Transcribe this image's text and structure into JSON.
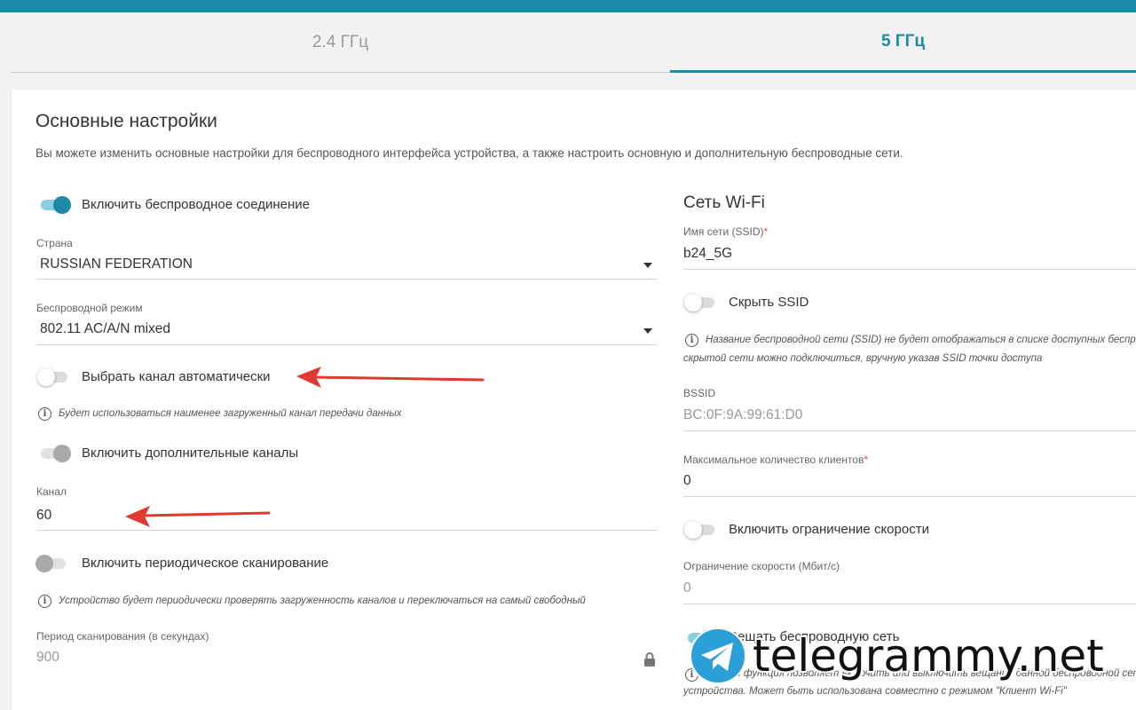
{
  "tabs": {
    "band_24": "2.4 ГГц",
    "band_5": "5 ГГц"
  },
  "main": {
    "title": "Основные настройки",
    "description": "Вы можете изменить основные настройки для беспроводного интерфейса устройства, а также настроить основную и дополнительную беспроводные сети."
  },
  "left": {
    "enable_wireless": "Включить беспроводное соединение",
    "country_label": "Страна",
    "country_value": "RUSSIAN FEDERATION",
    "mode_label": "Беспроводной режим",
    "mode_value": "802.11 AC/A/N mixed",
    "auto_channel": "Выбрать канал автоматически",
    "auto_channel_hint": "Будет использоваться наименее загруженный канал передачи данных",
    "extra_channels": "Включить дополнительные каналы",
    "channel_label": "Канал",
    "channel_value": "60",
    "periodic_scan": "Включить периодическое сканирование",
    "periodic_scan_hint": "Устройство будет периодически проверять загруженность каналов и переключаться на самый свободный",
    "scan_period_label": "Период сканирования (в секундах)",
    "scan_period_value": "900"
  },
  "right": {
    "section_title": "Сеть Wi-Fi",
    "ssid_label": "Имя сети (SSID)",
    "ssid_value": "b24_5G",
    "hide_ssid": "Скрыть SSID",
    "hide_ssid_hint_1": "Название беспроводной сети (SSID) не будет отображаться в списке доступных беспров",
    "hide_ssid_hint_2": "скрытой сети можно подключиться, вручную указав SSID точки доступа",
    "bssid_label": "BSSID",
    "bssid_value": "BC:0F:9A:99:61:D0",
    "max_clients_label": "Максимальное количество клиентов",
    "max_clients_value": "0",
    "speed_limit": "Включить ограничение скорости",
    "speed_limit_label": "Ограничение скорости (Мбит/с)",
    "speed_limit_value": "0",
    "broadcast": "Вещать беспроводную сеть",
    "broadcast_hint_1": "Данная функция позволяет включить или выключить вещание данной беспроводной сети",
    "broadcast_hint_2": "устройства. Может быть использована совместно с режимом \"Клиент Wi-Fi\""
  },
  "required_mark": "*",
  "info_glyph": "i",
  "watermark": "telegrammy.net",
  "colors": {
    "accent": "#1a8aa8",
    "arrow": "#e03a30"
  }
}
